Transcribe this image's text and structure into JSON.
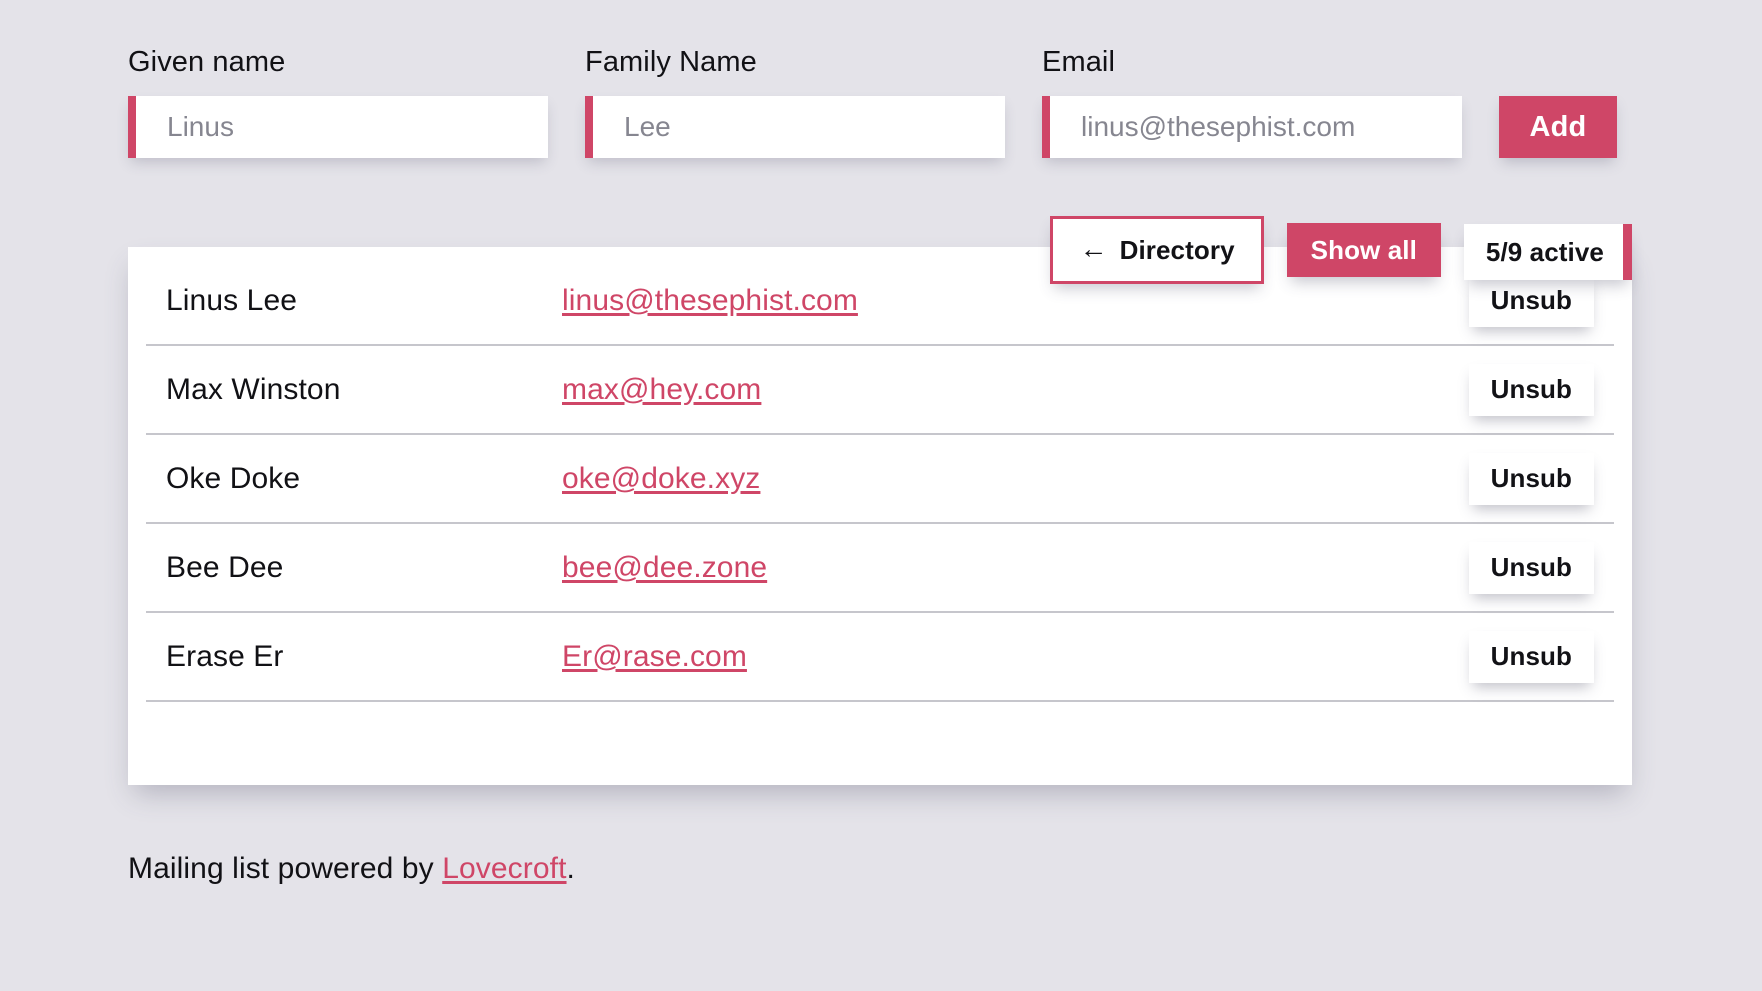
{
  "theme": {
    "accent": "#cf4667",
    "background": "#e4e3e9",
    "card_background": "#ffffff",
    "text": "#111115",
    "placeholder_text": "#868690",
    "divider": "#c6c6cc"
  },
  "form": {
    "given_name": {
      "label": "Given name",
      "placeholder": "Linus",
      "value": ""
    },
    "family_name": {
      "label": "Family Name",
      "placeholder": "Lee",
      "value": ""
    },
    "email": {
      "label": "Email",
      "placeholder": "linus@thesephist.com",
      "value": ""
    },
    "add_button": "Add"
  },
  "controls": {
    "directory_icon": "arrow-left-icon",
    "directory_arrow": "←",
    "directory_label": "Directory",
    "show_all_label": "Show all",
    "active_count_label": "5/9 active"
  },
  "list": {
    "unsub_label": "Unsub",
    "rows": [
      {
        "name": "Linus Lee",
        "email": "linus@thesephist.com",
        "action": "Unsub"
      },
      {
        "name": "Max Winston",
        "email": "max@hey.com",
        "action": "Unsub"
      },
      {
        "name": "Oke Doke",
        "email": "oke@doke.xyz",
        "action": "Unsub"
      },
      {
        "name": "Bee Dee",
        "email": "bee@dee.zone",
        "action": "Unsub"
      },
      {
        "name": "Erase Er",
        "email": "Er@rase.com",
        "action": "Unsub"
      }
    ]
  },
  "footer": {
    "prefix": "Mailing list powered by ",
    "link": "Lovecroft",
    "suffix": "."
  }
}
